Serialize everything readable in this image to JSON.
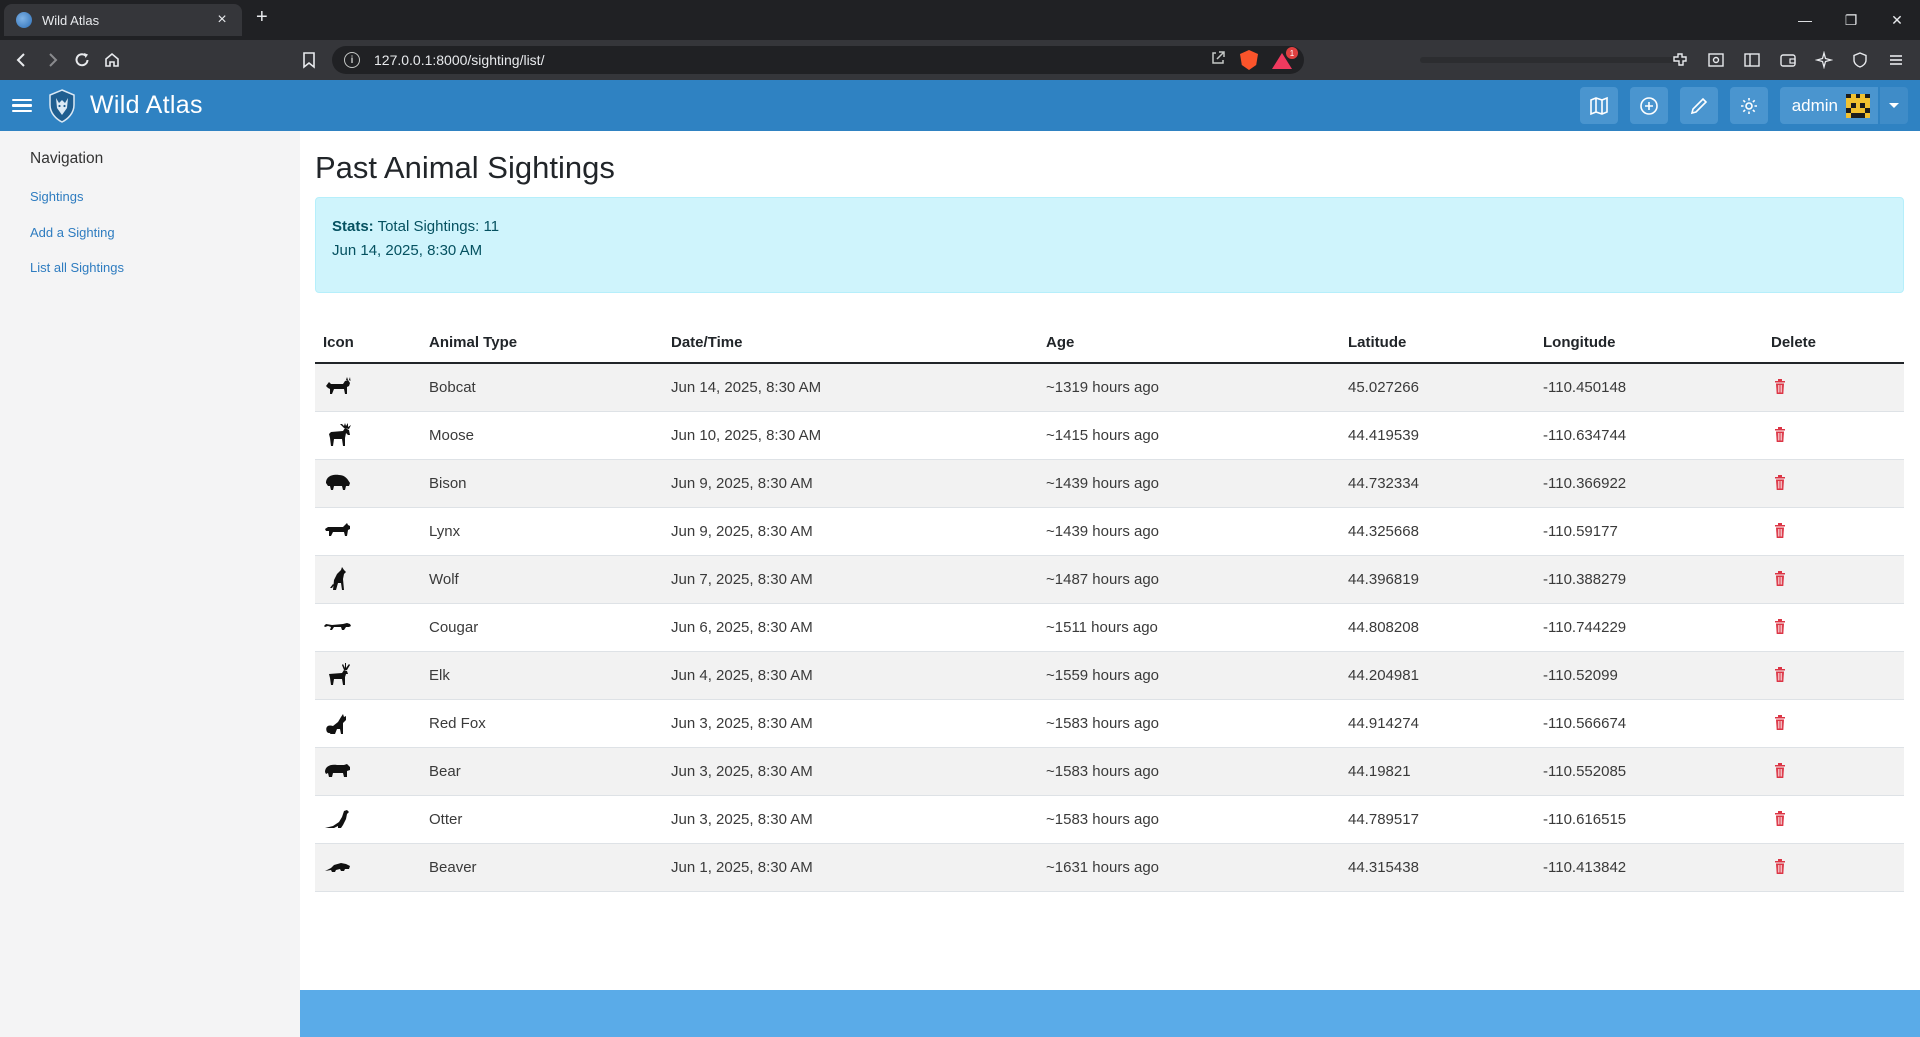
{
  "browser": {
    "tab_title": "Wild Atlas",
    "tab_close": "×",
    "new_tab": "+",
    "url": "127.0.0.1:8000/sighting/list/",
    "shield_badge": "1"
  },
  "header": {
    "brand": "Wild Atlas",
    "user": "admin"
  },
  "sidebar": {
    "title": "Navigation",
    "links": [
      "Sightings",
      "Add a Sighting",
      "List all Sightings"
    ]
  },
  "main": {
    "title": "Past Animal Sightings",
    "stats_label": "Stats:",
    "stats_text": "Total Sightings: 11",
    "stats_date": "Jun 14, 2025, 8:30 AM",
    "columns": [
      "Icon",
      "Animal Type",
      "Date/Time",
      "Age",
      "Latitude",
      "Longitude",
      "Delete"
    ],
    "rows": [
      {
        "icon": "bobcat-icon",
        "animal": "Bobcat",
        "date": "Jun 14, 2025, 8:30 AM",
        "age": "~1319 hours ago",
        "lat": "45.027266",
        "lon": "-110.450148"
      },
      {
        "icon": "moose-icon",
        "animal": "Moose",
        "date": "Jun 10, 2025, 8:30 AM",
        "age": "~1415 hours ago",
        "lat": "44.419539",
        "lon": "-110.634744"
      },
      {
        "icon": "bison-icon",
        "animal": "Bison",
        "date": "Jun 9, 2025, 8:30 AM",
        "age": "~1439 hours ago",
        "lat": "44.732334",
        "lon": "-110.366922"
      },
      {
        "icon": "lynx-icon",
        "animal": "Lynx",
        "date": "Jun 9, 2025, 8:30 AM",
        "age": "~1439 hours ago",
        "lat": "44.325668",
        "lon": "-110.59177"
      },
      {
        "icon": "wolf-icon",
        "animal": "Wolf",
        "date": "Jun 7, 2025, 8:30 AM",
        "age": "~1487 hours ago",
        "lat": "44.396819",
        "lon": "-110.388279"
      },
      {
        "icon": "cougar-icon",
        "animal": "Cougar",
        "date": "Jun 6, 2025, 8:30 AM",
        "age": "~1511 hours ago",
        "lat": "44.808208",
        "lon": "-110.744229"
      },
      {
        "icon": "elk-icon",
        "animal": "Elk",
        "date": "Jun 4, 2025, 8:30 AM",
        "age": "~1559 hours ago",
        "lat": "44.204981",
        "lon": "-110.52099"
      },
      {
        "icon": "fox-icon",
        "animal": "Red Fox",
        "date": "Jun 3, 2025, 8:30 AM",
        "age": "~1583 hours ago",
        "lat": "44.914274",
        "lon": "-110.566674"
      },
      {
        "icon": "bear-icon",
        "animal": "Bear",
        "date": "Jun 3, 2025, 8:30 AM",
        "age": "~1583 hours ago",
        "lat": "44.19821",
        "lon": "-110.552085"
      },
      {
        "icon": "otter-icon",
        "animal": "Otter",
        "date": "Jun 3, 2025, 8:30 AM",
        "age": "~1583 hours ago",
        "lat": "44.789517",
        "lon": "-110.616515"
      },
      {
        "icon": "beaver-icon",
        "animal": "Beaver",
        "date": "Jun 1, 2025, 8:30 AM",
        "age": "~1631 hours ago",
        "lat": "44.315438",
        "lon": "-110.413842"
      }
    ]
  },
  "colors": {
    "header": "#2f82c2",
    "footer": "#5aabe8",
    "stats_bg": "#cff4fc",
    "delete": "#dc3545",
    "link": "#2e7cc0"
  }
}
